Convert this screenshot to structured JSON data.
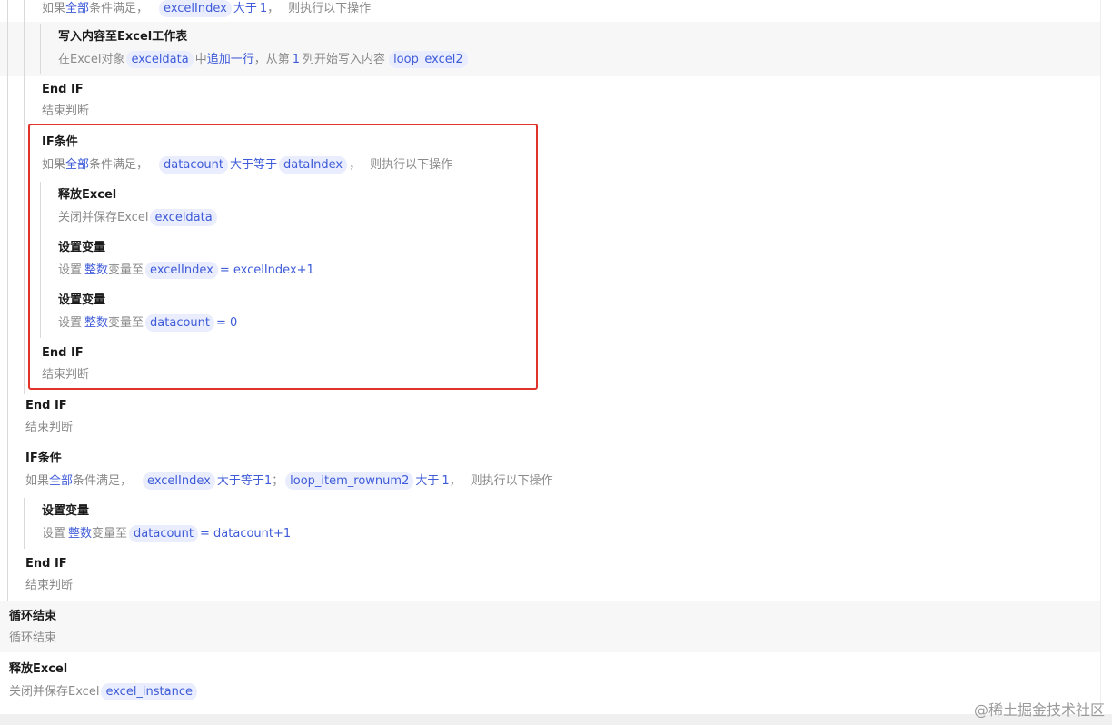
{
  "steps": {
    "if_top": {
      "desc_prefix": "如果",
      "desc_all": "全部",
      "desc_cond": "条件满足，",
      "var": "excelIndex",
      "op": "大于",
      "value": "1",
      "sep": "，",
      "desc_suffix": "则执行以下操作"
    },
    "write_excel": {
      "title": "写入内容至Excel工作表",
      "desc_a": "在Excel对象",
      "obj": "exceldata",
      "desc_b": "中",
      "action": "追加一行",
      "desc_c": "，从第",
      "col": "1",
      "desc_d": "列开始写入内容",
      "content": "loop_excel2"
    },
    "endif_1": {
      "title": "End IF",
      "desc": "结束判断"
    },
    "if_2": {
      "title": "IF条件",
      "desc_prefix": "如果",
      "desc_all": "全部",
      "desc_cond": "条件满足，",
      "var": "datacount",
      "op": "大于等于",
      "var2": "dataIndex",
      "sep": "，",
      "desc_suffix": "则执行以下操作"
    },
    "release_excel_1": {
      "title": "释放Excel",
      "desc": "关闭并保存Excel",
      "obj": "exceldata"
    },
    "set_var_1": {
      "title": "设置变量",
      "desc_a": "设置",
      "type": "整数",
      "desc_b": "变量至",
      "var": "excelIndex",
      "expr": "= excelIndex+1"
    },
    "set_var_2": {
      "title": "设置变量",
      "desc_a": "设置",
      "type": "整数",
      "desc_b": "变量至",
      "var": "datacount",
      "expr": "= 0"
    },
    "endif_2": {
      "title": "End IF",
      "desc": "结束判断"
    },
    "endif_3": {
      "title": "End IF",
      "desc": "结束判断"
    },
    "if_3": {
      "title": "IF条件",
      "desc_prefix": "如果",
      "desc_all": "全部",
      "desc_cond": "条件满足，",
      "var": "excelIndex",
      "op": "大于等于",
      "value": "1",
      "semi": "；",
      "var2": "loop_item_rownum2",
      "op2": "大于",
      "value2": "1",
      "sep": "，",
      "desc_suffix": "则执行以下操作"
    },
    "set_var_3": {
      "title": "设置变量",
      "desc_a": "设置",
      "type": "整数",
      "desc_b": "变量至",
      "var": "datacount",
      "expr": "= datacount+1"
    },
    "endif_4": {
      "title": "End IF",
      "desc": "结束判断"
    },
    "loop_end": {
      "title": "循环结束",
      "desc": "循环结束"
    },
    "release_excel_2": {
      "title": "释放Excel",
      "desc": "关闭并保存Excel",
      "obj": "excel_instance"
    }
  },
  "watermark": "@稀土掘金技术社区",
  "colors": {
    "accent": "#3e5bd8",
    "pill_bg": "#eaedfd",
    "highlight_border": "#e0332b",
    "muted_text": "#8a8a8a"
  }
}
